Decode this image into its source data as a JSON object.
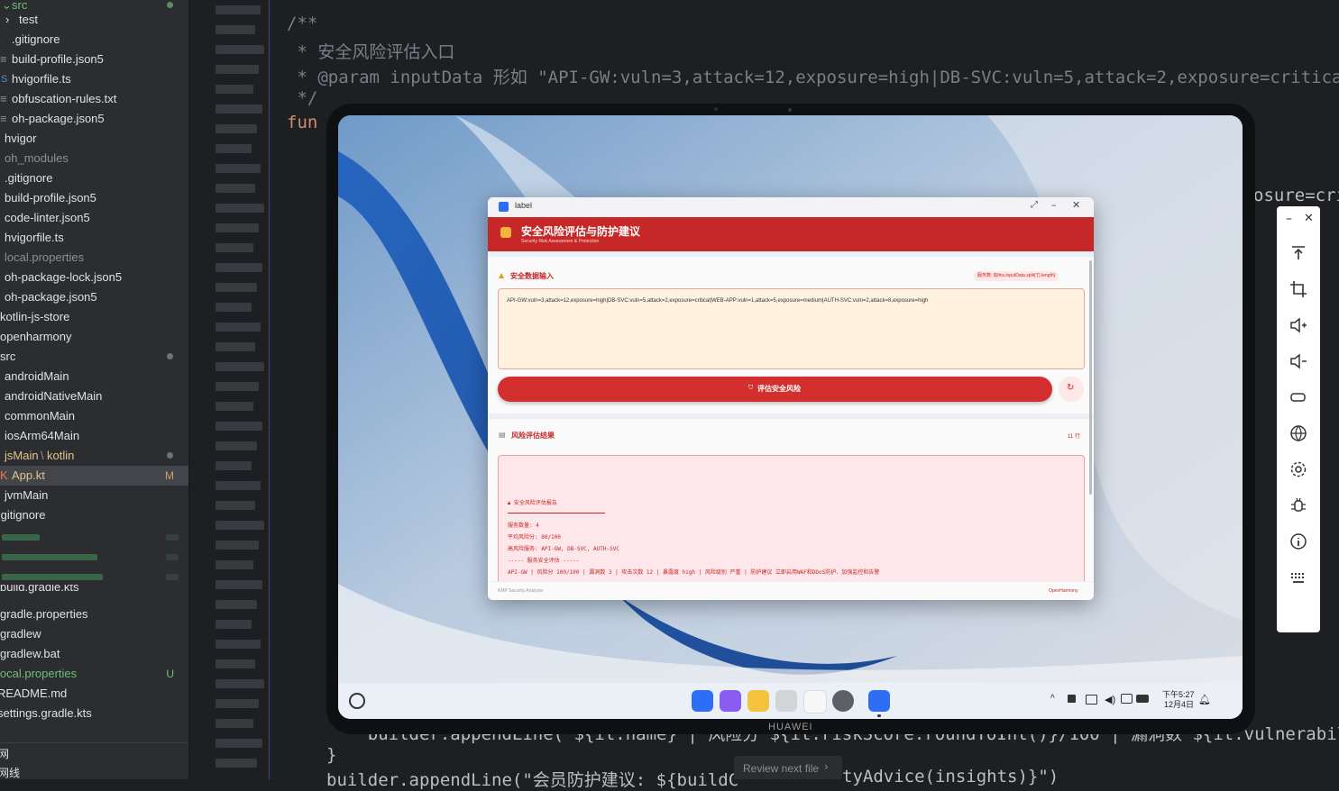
{
  "file_tree": {
    "items": [
      {
        "label": "src",
        "marker": "green-dot"
      },
      {
        "label": "test"
      },
      {
        "label": ".gitignore"
      },
      {
        "label": "build-profile.json5"
      },
      {
        "label": "hvigorfile.ts"
      },
      {
        "label": "obfuscation-rules.txt"
      },
      {
        "label": "oh-package.json5"
      },
      {
        "label": "hvigor"
      },
      {
        "label": "oh_modules"
      },
      {
        "label": ".gitignore"
      },
      {
        "label": "build-profile.json5"
      },
      {
        "label": "code-linter.json5"
      },
      {
        "label": "hvigorfile.ts"
      },
      {
        "label": "local.properties"
      },
      {
        "label": "oh-package-lock.json5"
      },
      {
        "label": "oh-package.json5"
      },
      {
        "label": "kotlin-js-store"
      },
      {
        "label": "openharmony"
      },
      {
        "label": "src",
        "marker": "dot"
      },
      {
        "label": "androidMain"
      },
      {
        "label": "androidNativeMain"
      },
      {
        "label": "commonMain"
      },
      {
        "label": "iosArm64Main"
      },
      {
        "label": "jsMain",
        "suffix": "kotlin",
        "marker": "dot"
      },
      {
        "label": "App.kt",
        "badge": "M"
      },
      {
        "label": "jvmMain"
      },
      {
        "label": ".gitignore"
      },
      {
        "label": "build.gradle.kts"
      },
      {
        "label": "gradle.properties"
      },
      {
        "label": "gradlew"
      },
      {
        "label": "gradlew.bat"
      },
      {
        "label": "local.properties",
        "badge": "U"
      },
      {
        "label": "README.md"
      },
      {
        "label": "settings.gradle.kts"
      }
    ],
    "bottom_items": [
      "网",
      "网线"
    ]
  },
  "editor": {
    "lines": {
      "l1": "/**",
      "l2": " * 安全风险评估入口",
      "l3": " * @param inputData 形如 \"API-GW:vuln=3,attack=12,exposure=high|DB-SVC:vuln=5,attack=2,exposure=critical\"",
      "l4": " */",
      "l5": "fun",
      "l6": "osure=cri",
      "l7": "    builder.appendLine(\"${it.name} | 风险分 ${it.riskScore.roundToInt()}/100 | 漏洞数 ${it.vulnerability",
      "l8": "}",
      "l9": "builder.appendLine(\"会员防护建议: ${buildC",
      "l9b": "tyAdvice(insights)}\")"
    },
    "review_button": "Review next file",
    "review_chevron": "›"
  },
  "device": {
    "brand": "HUAWEI",
    "time": "下午5:27",
    "date": "12月4日"
  },
  "app": {
    "window_title": "label",
    "header_title": "安全风险评估与防护建议",
    "header_subtitle": "Security Risk Assessment & Protection",
    "input_section_title": "安全数据输入",
    "input_counter": "服务数: ${this.inputData.split('|').length}",
    "input_value": "API-GW:vuln=3,attack=12,exposure=high|DB-SVC:vuln=5,attack=2,exposure=critical|WEB-APP:vuln=1,attack=5,exposure=medium|AUTH-SVC:vuln=2,attack=8,exposure=high",
    "evaluate_button": "评估安全风险",
    "result_section_title": "风险评估结果",
    "result_lines_count": "11 行",
    "report": {
      "title": "安全风险评估报告",
      "services": "服务数量: 4",
      "avg_score": "平均风险分: 80/100",
      "high_risk": "高风险服务: API-GW, DB-SVC, AUTH-SVC",
      "divider": "----- 服务安全评估 -----",
      "row1": "API-GW | 风险分 100/100 | 漏洞数 3 | 攻击次数 12 | 暴露度 high | 风险级别 严重 | 防护建议 立即启用WAF和DDoS防护、加强监控和告警"
    },
    "footer_left": "KMP Security Analyzer",
    "footer_right": "OpenHarmony"
  },
  "colors": {
    "accent_red": "#c62828",
    "ide_bg": "#1e1f22",
    "tree_bg": "#2b2d30"
  }
}
